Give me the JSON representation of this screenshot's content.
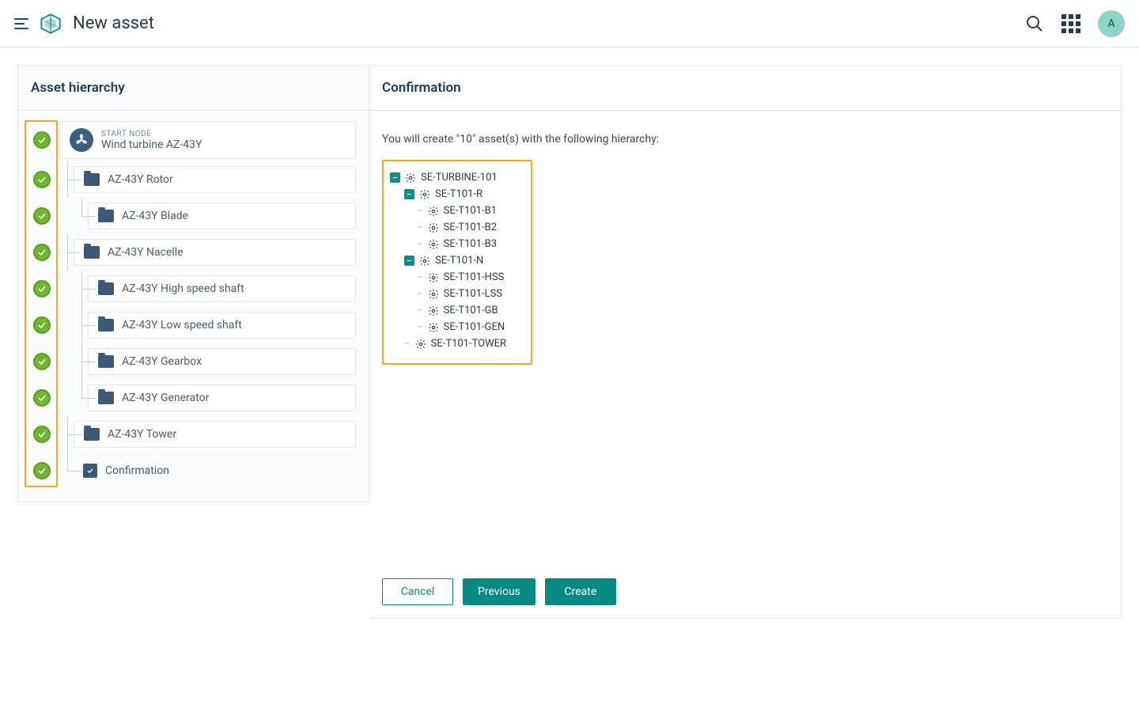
{
  "header": {
    "title": "New asset",
    "avatar_initial": "A"
  },
  "sidepanel": {
    "title": "Asset hierarchy",
    "start_node_label": "START NODE",
    "steps": [
      {
        "type": "start",
        "label": "Wind turbine AZ-43Y",
        "indent": 0
      },
      {
        "type": "folder",
        "label": "AZ-43Y Rotor",
        "indent": 1
      },
      {
        "type": "folder",
        "label": "AZ-43Y Blade",
        "indent": 2
      },
      {
        "type": "folder",
        "label": "AZ-43Y Nacelle",
        "indent": 1
      },
      {
        "type": "folder",
        "label": "AZ-43Y High speed shaft",
        "indent": 2
      },
      {
        "type": "folder",
        "label": "AZ-43Y Low speed shaft",
        "indent": 2
      },
      {
        "type": "folder",
        "label": "AZ-43Y Gearbox",
        "indent": 2
      },
      {
        "type": "folder",
        "label": "AZ-43Y Generator",
        "indent": 2
      },
      {
        "type": "folder",
        "label": "AZ-43Y Tower",
        "indent": 1
      },
      {
        "type": "confirm",
        "label": "Confirmation",
        "indent": 1
      }
    ]
  },
  "main": {
    "title": "Confirmation",
    "message": "You will create \"10\" asset(s) with the following hierarchy:",
    "preview": [
      {
        "label": "SE-TURBINE-101",
        "indent": 0,
        "collapse": true
      },
      {
        "label": "SE-T101-R",
        "indent": 1,
        "collapse": true
      },
      {
        "label": "SE-T101-B1",
        "indent": 2
      },
      {
        "label": "SE-T101-B2",
        "indent": 2
      },
      {
        "label": "SE-T101-B3",
        "indent": 2
      },
      {
        "label": "SE-T101-N",
        "indent": 1,
        "collapse": true
      },
      {
        "label": "SE-T101-HSS",
        "indent": 2
      },
      {
        "label": "SE-T101-LSS",
        "indent": 2
      },
      {
        "label": "SE-T101-GB",
        "indent": 2
      },
      {
        "label": "SE-T101-GEN",
        "indent": 2
      },
      {
        "label": "SE-T101-TOWER",
        "indent": 1
      }
    ],
    "buttons": {
      "cancel": "Cancel",
      "previous": "Previous",
      "create": "Create"
    }
  }
}
